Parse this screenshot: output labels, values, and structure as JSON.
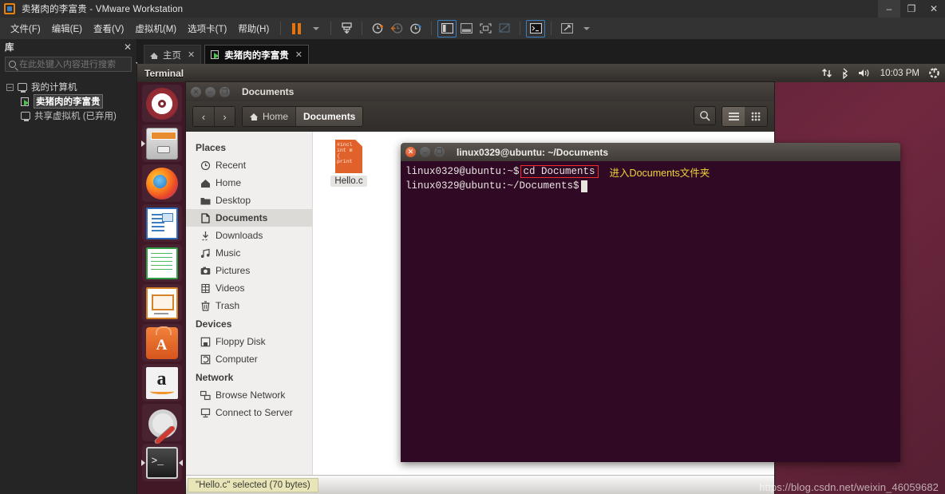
{
  "vmware": {
    "window_title": "卖猪肉的李富贵 - VMware Workstation",
    "window_buttons": {
      "minimize": "–",
      "restore": "❐",
      "close": "✕"
    },
    "menus": [
      "文件(F)",
      "编辑(E)",
      "查看(V)",
      "虚拟机(M)",
      "选项卡(T)",
      "帮助(H)"
    ],
    "toolbar_icons": [
      "pause-icon",
      "dropdown-caret-icon",
      "snapshot-icon",
      "take-snapshot-icon",
      "revert-snapshot-icon",
      "snapshot-manager-icon",
      "show-library-icon",
      "show-thumbnails-icon",
      "fullscreen-icon",
      "unity-mode-icon",
      "console-view-icon",
      "stretch-icon",
      "stretch-caret-icon"
    ],
    "library": {
      "title": "库",
      "close_label": "✕",
      "search_placeholder": "在此处键入内容进行搜索",
      "tree": [
        {
          "label": "我的计算机",
          "icon": "computer-icon",
          "expander": "–",
          "level": 0,
          "selected": false
        },
        {
          "label": "卖猪肉的李富贵",
          "icon": "vm-running-icon",
          "level": 1,
          "selected": true
        },
        {
          "label": "共享虚拟机 (已弃用)",
          "icon": "shared-vm-icon",
          "level": 1,
          "selected": false
        }
      ]
    },
    "tabs": [
      {
        "label": "主页",
        "icon": "home-icon",
        "active": false,
        "close": "✕"
      },
      {
        "label": "卖猪肉的李富贵",
        "icon": "vm-running-icon",
        "active": true,
        "close": "✕"
      }
    ]
  },
  "guest": {
    "unity_panel": {
      "app_title": "Terminal",
      "indicators": [
        "network-icon",
        "bluetooth-icon",
        "volume-icon"
      ],
      "clock": "10:03 PM",
      "session_icon": "power-gear-icon"
    },
    "launcher": [
      {
        "name": "ubuntu-dash-icon",
        "label": "Dash Home"
      },
      {
        "name": "files-icon",
        "label": "Files"
      },
      {
        "name": "firefox-icon",
        "label": "Firefox"
      },
      {
        "name": "libreoffice-writer-icon",
        "label": "LibreOffice Writer"
      },
      {
        "name": "libreoffice-calc-icon",
        "label": "LibreOffice Calc"
      },
      {
        "name": "libreoffice-impress-icon",
        "label": "LibreOffice Impress"
      },
      {
        "name": "ubuntu-software-icon",
        "label": "Ubuntu Software"
      },
      {
        "name": "amazon-icon",
        "label": "Amazon"
      },
      {
        "name": "system-settings-icon",
        "label": "System Settings"
      },
      {
        "name": "terminal-icon",
        "label": "Terminal"
      }
    ],
    "nautilus": {
      "title": "Documents",
      "nav": {
        "back": "‹",
        "forward": "›"
      },
      "breadcrumbs": [
        {
          "label": "Home",
          "icon": "home-icon",
          "active": false
        },
        {
          "label": "Documents",
          "icon": "",
          "active": true
        }
      ],
      "toolbar_right": [
        "search-icon",
        "list-view-icon",
        "grid-view-icon"
      ],
      "sidebar": [
        {
          "type": "header",
          "label": "Places"
        },
        {
          "type": "item",
          "label": "Recent",
          "icon": "clock-icon",
          "active": false
        },
        {
          "type": "item",
          "label": "Home",
          "icon": "home-icon",
          "active": false
        },
        {
          "type": "item",
          "label": "Desktop",
          "icon": "folder-icon",
          "active": false
        },
        {
          "type": "item",
          "label": "Documents",
          "icon": "document-icon",
          "active": true
        },
        {
          "type": "item",
          "label": "Downloads",
          "icon": "download-icon",
          "active": false
        },
        {
          "type": "item",
          "label": "Music",
          "icon": "music-icon",
          "active": false
        },
        {
          "type": "item",
          "label": "Pictures",
          "icon": "camera-icon",
          "active": false
        },
        {
          "type": "item",
          "label": "Videos",
          "icon": "film-icon",
          "active": false
        },
        {
          "type": "item",
          "label": "Trash",
          "icon": "trash-icon",
          "active": false
        },
        {
          "type": "header",
          "label": "Devices"
        },
        {
          "type": "item",
          "label": "Floppy Disk",
          "icon": "floppy-icon",
          "active": false
        },
        {
          "type": "item",
          "label": "Computer",
          "icon": "computer-icon",
          "active": false
        },
        {
          "type": "header",
          "label": "Network"
        },
        {
          "type": "item",
          "label": "Browse Network",
          "icon": "network-icon",
          "active": false
        },
        {
          "type": "item",
          "label": "Connect to Server",
          "icon": "server-icon",
          "active": false
        }
      ],
      "files": [
        {
          "name": "Hello.c",
          "thumb_text": "#incl\nint m\n{\nprint",
          "selected": true
        }
      ],
      "status": "\"Hello.c\" selected  (70 bytes)"
    },
    "terminal": {
      "title": "linux0329@ubuntu: ~/Documents",
      "window_buttons": {
        "close": "✕",
        "minimize": "–",
        "maximize": "❐"
      },
      "lines": [
        {
          "prompt": "linux0329@ubuntu:~$",
          "command": "cd Documents",
          "boxed": true,
          "note": "进入Documents文件夹"
        },
        {
          "prompt": "linux0329@ubuntu:~/Documents$",
          "command": "",
          "boxed": false,
          "cursor": true
        }
      ]
    },
    "watermark": "https://blog.csdn.net/weixin_46059682"
  },
  "colors": {
    "vmware_chrome": "#2d2d2d",
    "ubuntu_aubergine": "#5a2236",
    "terminal_bg": "#300a24",
    "highlight_red": "#ef2b2b",
    "note_yellow": "#f0d43a",
    "accent_orange": "#e8730c"
  }
}
